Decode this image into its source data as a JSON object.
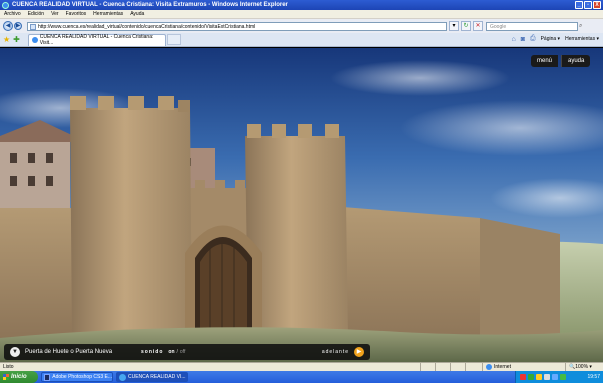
{
  "window": {
    "title": "CUENCA REALIDAD VIRTUAL - Cuenca Cristiana: Visita Extramuros - Windows Internet Explorer",
    "controls": [
      "_",
      "▫",
      "X"
    ]
  },
  "menubar": {
    "items": [
      "Archivo",
      "Edición",
      "Ver",
      "Favoritos",
      "Herramientas",
      "Ayuda"
    ]
  },
  "addressbar": {
    "url": "http://www.cuenca.es/realidad_virtual/contenido/cuencaCristiana/contenido/VisitaExtCristiana.html",
    "search_placeholder": "Google"
  },
  "tabs": {
    "active_title": "CUENCA REALIDAD VIRTUAL - Cuenca Cristiana: Visit..."
  },
  "commandbar": {
    "page_label": "Página",
    "tools_label": "Herramientas"
  },
  "app": {
    "menu_label": "menú",
    "help_label": "ayuda",
    "caption_title": "Puerta de Huete o Puerta Nueva",
    "sound_label": "sonido",
    "sound_on": "on",
    "sound_sep": "/",
    "sound_off": "off",
    "next_label": "adelante"
  },
  "statusbar": {
    "status_text": "Listo",
    "zone": "Internet",
    "zoom": "100%"
  },
  "taskbar": {
    "start_label": "Inicio",
    "tasks": [
      "Adobe Photoshop CS3 E...",
      "CUENCA REALIDAD VI..."
    ],
    "clock": "19:57"
  },
  "colors": {
    "sky_top": "#1c3e84",
    "stone": "#b59a72",
    "accent_next": "#f0a21c"
  }
}
